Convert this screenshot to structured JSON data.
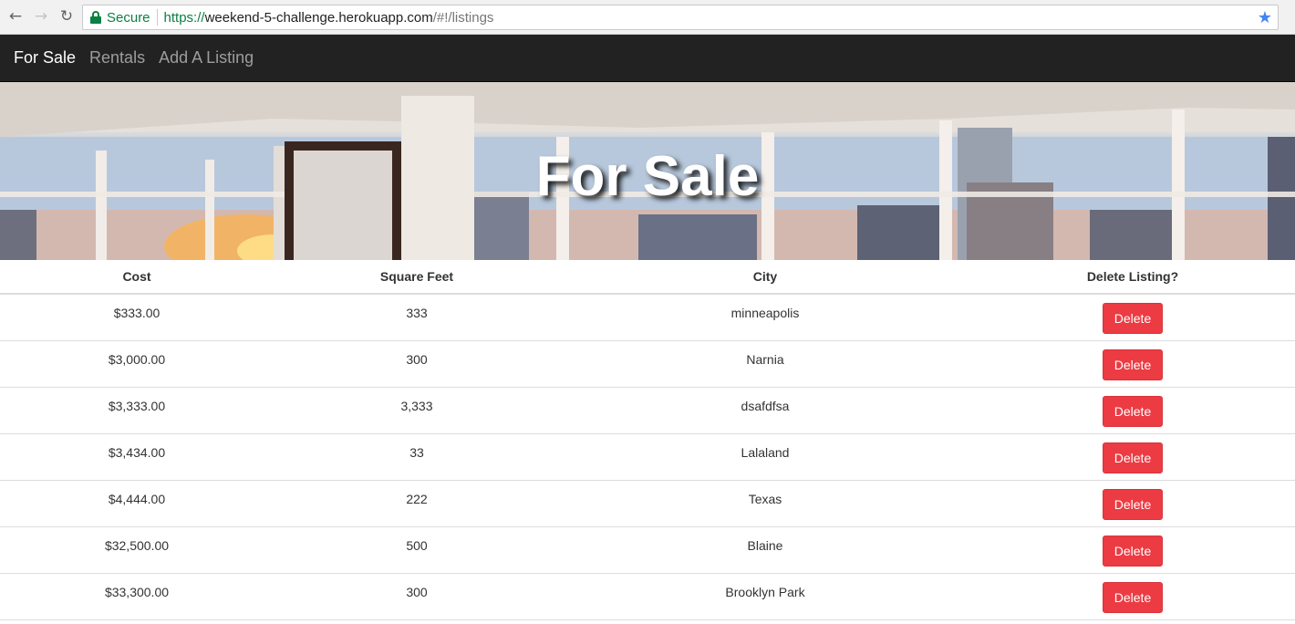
{
  "browser": {
    "secure_label": "Secure",
    "url_scheme": "https://",
    "url_host": "weekend-5-challenge.herokuapp.com",
    "url_path": "/#!/listings",
    "icons": [
      "back-icon",
      "forward-icon",
      "reload-icon",
      "lock-icon",
      "star-icon"
    ]
  },
  "nav": {
    "items": [
      {
        "label": "For Sale",
        "active": true
      },
      {
        "label": "Rentals",
        "active": false
      },
      {
        "label": "Add A Listing",
        "active": false
      }
    ]
  },
  "hero": {
    "heading": "For Sale"
  },
  "table": {
    "headers": [
      "Cost",
      "Square Feet",
      "City",
      "Delete Listing?"
    ],
    "rows": [
      {
        "cost": "$333.00",
        "sqft": "333",
        "city": "minneapolis",
        "action": "Delete"
      },
      {
        "cost": "$3,000.00",
        "sqft": "300",
        "city": "Narnia",
        "action": "Delete"
      },
      {
        "cost": "$3,333.00",
        "sqft": "3,333",
        "city": "dsafdfsa",
        "action": "Delete"
      },
      {
        "cost": "$3,434.00",
        "sqft": "33",
        "city": "Lalaland",
        "action": "Delete"
      },
      {
        "cost": "$4,444.00",
        "sqft": "222",
        "city": "Texas",
        "action": "Delete"
      },
      {
        "cost": "$32,500.00",
        "sqft": "500",
        "city": "Blaine",
        "action": "Delete"
      },
      {
        "cost": "$33,300.00",
        "sqft": "300",
        "city": "Brooklyn Park",
        "action": "Delete"
      }
    ]
  },
  "colors": {
    "navbar_bg": "#222222",
    "nav_active": "#ffffff",
    "nav_inactive": "#9d9d9d",
    "delete_button": "#ec3b43",
    "secure_green": "#0b8043"
  }
}
